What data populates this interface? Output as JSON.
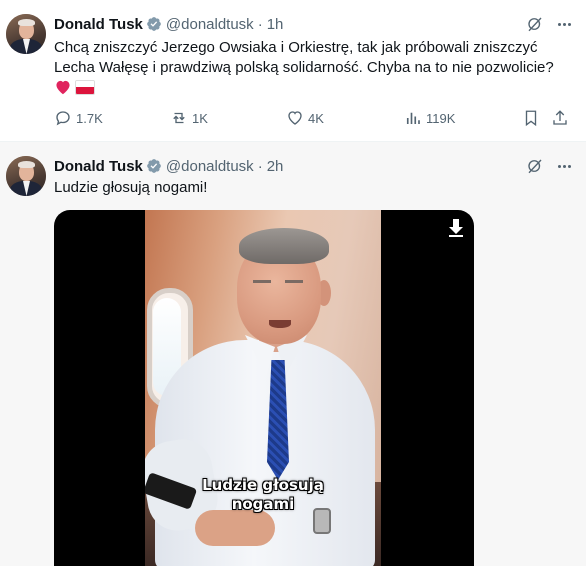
{
  "tweets": [
    {
      "author_name": "Donald Tusk",
      "handle": "@donaldtusk",
      "separator": "·",
      "time": "1h",
      "text_line1": "Chcą zniszczyć Jerzego Owsiaka i Orkiestrę, tak jak próbowali zniszczyć",
      "text_line2": "Lecha Wałęsę i prawdziwą polską solidarność. Chyba na to nie pozwolicie?",
      "emoji": [
        "red-heart",
        "poland-flag"
      ],
      "stats": {
        "replies": "1.7K",
        "reposts": "1K",
        "likes": "4K",
        "views": "119K"
      }
    },
    {
      "author_name": "Donald Tusk",
      "handle": "@donaldtusk",
      "separator": "·",
      "time": "2h",
      "text_line1": "Ludzie głosują nogami!",
      "video_caption_line1": "Ludzie głosują",
      "video_caption_line2": "nogami"
    }
  ],
  "colors": {
    "verified_blue": "#1d9bf0",
    "secondary_text": "#536471",
    "heart_red": "#e0245e"
  },
  "icons": [
    "grok-icon",
    "more-icon",
    "reply-icon",
    "repost-icon",
    "like-icon",
    "views-icon",
    "bookmark-icon",
    "share-icon",
    "download-icon",
    "verified-badge-icon"
  ]
}
